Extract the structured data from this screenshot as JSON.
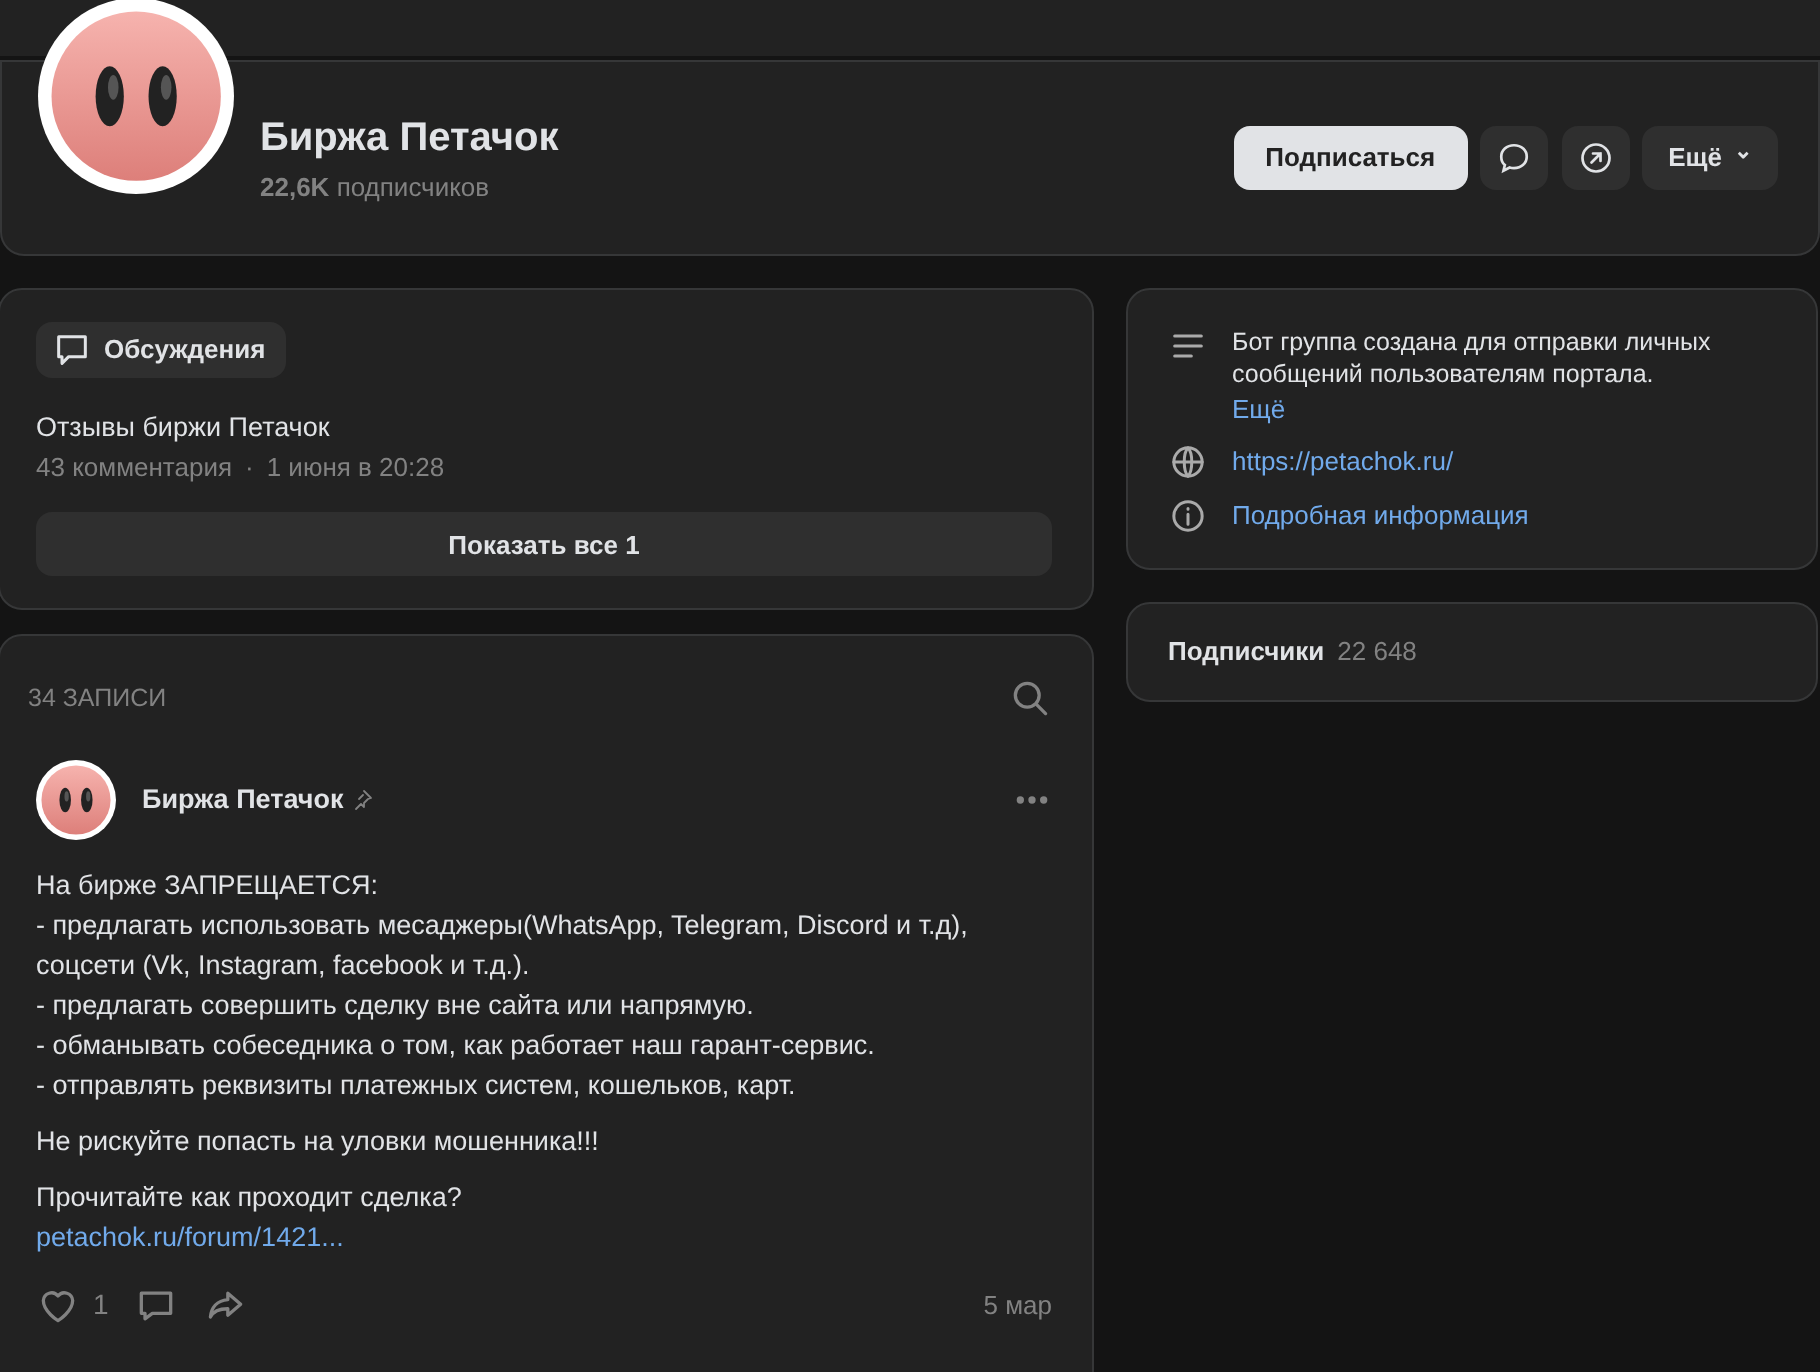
{
  "header": {
    "name": "Биржа Петачок",
    "subscribers_count": "22,6K",
    "subscribers_label": "подписчиков",
    "buttons": [
      {
        "kind": "primary",
        "label": "Подписаться"
      },
      {
        "kind": "message"
      },
      {
        "kind": "share"
      },
      {
        "kind": "more",
        "label": "Ещё",
        "caret": "⌄"
      }
    ]
  },
  "discussions": {
    "tab": "Обсуждения",
    "topic": "Отзывы биржи Петачок",
    "comments": "43 комментария",
    "separator": "·",
    "date": "1 июня в 20:28",
    "show_all": "Показать все 1"
  },
  "info": {
    "items": [
      {
        "kind": "description",
        "text": "Бот группа создана для отправки личных сообщений пользователям портала.",
        "more": "Ещё"
      },
      {
        "kind": "link",
        "text": "https://petachok.ru/"
      },
      {
        "kind": "details",
        "text": "Подробная информация"
      }
    ]
  },
  "followers": {
    "label": "Подписчики",
    "count": "22 648"
  },
  "wall": {
    "count": "34 ЗАПИСИ",
    "post": {
      "author": "Биржа Петачок",
      "pinned": true,
      "paragraphs": [
        [
          "На бирже ЗАПРЕЩАЕТСЯ:",
          "- предлагать использовать месаджеры(WhatsApp, Telegram, Discord и т.д), соцсети (Vk, Instagram, facebook и т.д.).",
          "- предлагать совершить сделку вне сайта или напрямую.",
          "- обманывать собеседника о том, как работает наш гарант-сервис.",
          "- отправлять реквизиты платежных систем, кошельков, карт."
        ],
        [
          "Не рискуйте попасть на уловки мошенника!!!"
        ],
        [
          "Прочитайте как проходит сделка?"
        ]
      ],
      "link": "petachok.ru/forum/1421...",
      "likes": "1",
      "date": "5 мар"
    }
  }
}
